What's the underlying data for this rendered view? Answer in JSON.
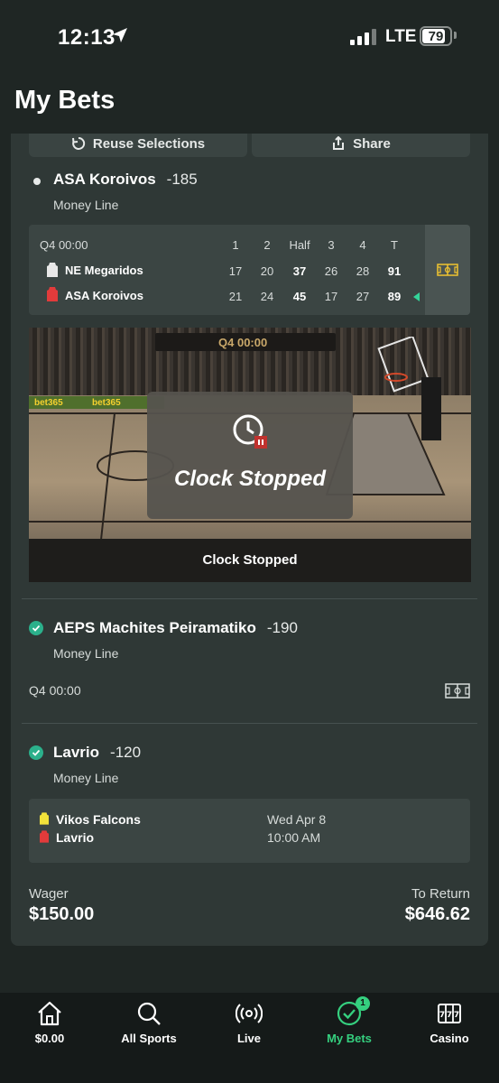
{
  "status_bar": {
    "time": "12:13",
    "network": "LTE",
    "battery": "79"
  },
  "page": {
    "title": "My Bets"
  },
  "actions": {
    "reuse_label": "Reuse Selections",
    "share_label": "Share"
  },
  "selections": [
    {
      "team": "ASA Koroivos",
      "odds": "-185",
      "market": "Money Line",
      "status": "pending"
    },
    {
      "team": "AEPS Machites Peiramatiko",
      "odds": "-190",
      "market": "Money Line",
      "status": "won",
      "clock": "Q4  00:00"
    },
    {
      "team": "Lavrio",
      "odds": "-120",
      "market": "Money Line",
      "status": "won"
    }
  ],
  "scoreboard": {
    "clock": "Q4 00:00",
    "columns": [
      "1",
      "2",
      "Half",
      "3",
      "4",
      "T"
    ],
    "teams": [
      {
        "name": "NE Megaridos",
        "scores": [
          "17",
          "20",
          "37",
          "26",
          "28",
          "91"
        ]
      },
      {
        "name": "ASA Koroivos",
        "scores": [
          "21",
          "24",
          "45",
          "17",
          "27",
          "89"
        ]
      }
    ]
  },
  "video": {
    "clock_period": "Q4",
    "clock_time": "00:00",
    "overlay_text": "Clock Stopped",
    "caption": "Clock Stopped",
    "ad_text": "bet365"
  },
  "upcoming_game": {
    "home": "Vikos Falcons",
    "away": "Lavrio",
    "date": "Wed Apr 8",
    "time": "10:00 AM"
  },
  "totals": {
    "wager_label": "Wager",
    "wager": "$150.00",
    "return_label": "To Return",
    "return": "$646.62"
  },
  "nav": {
    "items": [
      {
        "label": "$0.00"
      },
      {
        "label": "All Sports"
      },
      {
        "label": "Live"
      },
      {
        "label": "My Bets",
        "badge": "1"
      },
      {
        "label": "Casino"
      }
    ]
  },
  "colors": {
    "accent": "#35d07f",
    "check": "#2bb08b",
    "background": "#1f2624",
    "card": "#2f3836"
  }
}
